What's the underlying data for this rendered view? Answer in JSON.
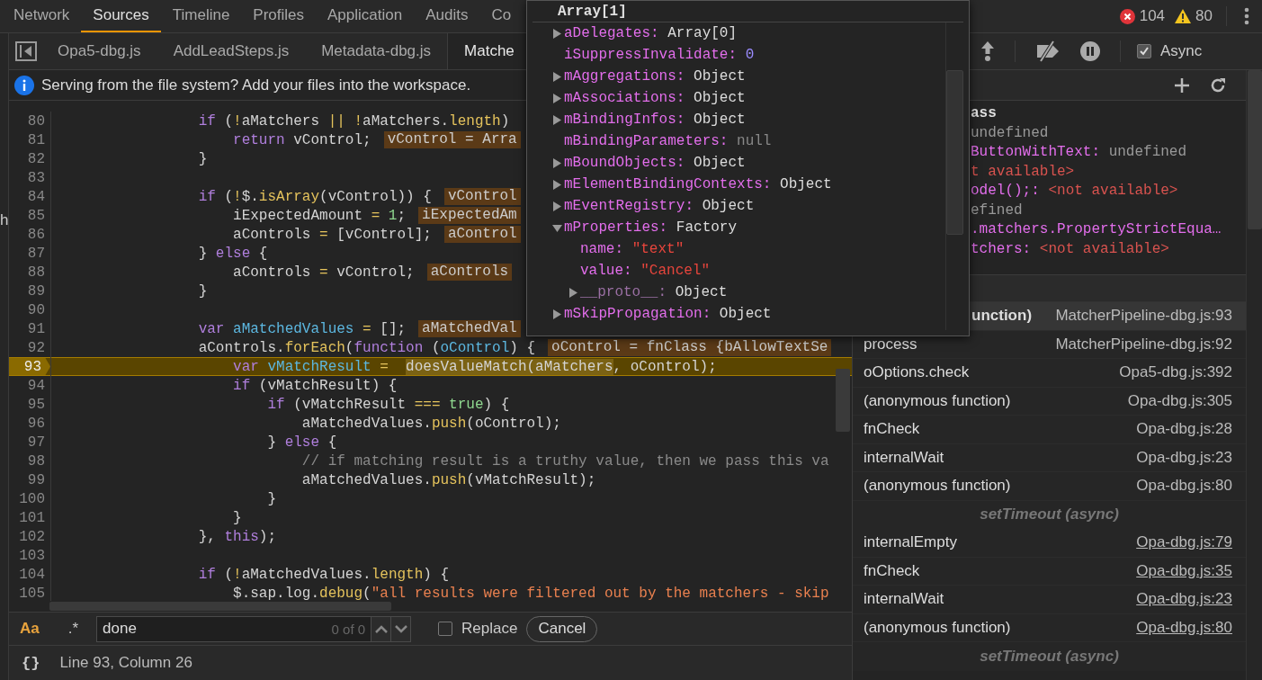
{
  "top_tabs": [
    {
      "label": "Network",
      "selected": false
    },
    {
      "label": "Sources",
      "selected": true
    },
    {
      "label": "Timeline",
      "selected": false
    },
    {
      "label": "Profiles",
      "selected": false
    },
    {
      "label": "Application",
      "selected": false
    },
    {
      "label": "Audits",
      "selected": false
    },
    {
      "label": "Co",
      "selected": false
    }
  ],
  "console_counts": {
    "errors": "104",
    "warnings": "80"
  },
  "navigator_edge_text": "h",
  "editor_tabs": [
    {
      "label": "Opa5-dbg.js",
      "selected": false
    },
    {
      "label": "AddLeadSteps.js",
      "selected": false
    },
    {
      "label": "Metadata-dbg.js",
      "selected": false
    },
    {
      "label": "Matche",
      "selected": true
    }
  ],
  "infobar": {
    "message": "Serving from the file system? Add your files into the workspace."
  },
  "code_lines": [
    {
      "number": "80",
      "current": false,
      "tokens": [
        {
          "kind": "keyword",
          "text": "                if"
        },
        {
          "kind": "plain",
          "text": " ("
        },
        {
          "kind": "operator",
          "text": "!"
        },
        {
          "kind": "plain",
          "text": "aMatchers "
        },
        {
          "kind": "operator",
          "text": "|| !"
        },
        {
          "kind": "plain",
          "text": "aMatchers."
        },
        {
          "kind": "method",
          "text": "length"
        },
        {
          "kind": "plain",
          "text": ")"
        }
      ]
    },
    {
      "number": "81",
      "current": false,
      "tokens": [
        {
          "kind": "keyword",
          "text": "                    return"
        },
        {
          "kind": "plain",
          "text": " vControl;"
        }
      ],
      "inline_value": "vControl = Arra"
    },
    {
      "number": "82",
      "current": false,
      "tokens": [
        {
          "kind": "plain",
          "text": "                }"
        }
      ]
    },
    {
      "number": "83",
      "current": false
    },
    {
      "number": "84",
      "current": false,
      "tokens": [
        {
          "kind": "keyword",
          "text": "                if"
        },
        {
          "kind": "plain",
          "text": " ("
        },
        {
          "kind": "operator",
          "text": "!"
        },
        {
          "kind": "plain",
          "text": "$."
        },
        {
          "kind": "method",
          "text": "isArray"
        },
        {
          "kind": "plain",
          "text": "(vControl)) {"
        }
      ],
      "inline_value": "vControl"
    },
    {
      "number": "85",
      "current": false,
      "tokens": [
        {
          "kind": "plain",
          "text": "                    iExpectedAmount "
        },
        {
          "kind": "operator",
          "text": "= "
        },
        {
          "kind": "number",
          "text": "1"
        },
        {
          "kind": "plain",
          "text": ";"
        }
      ],
      "inline_value": "iExpectedAm"
    },
    {
      "number": "86",
      "current": false,
      "tokens": [
        {
          "kind": "plain",
          "text": "                    aControls "
        },
        {
          "kind": "operator",
          "text": "="
        },
        {
          "kind": "plain",
          "text": " [vControl];"
        }
      ],
      "inline_value": "aControl"
    },
    {
      "number": "87",
      "current": false,
      "tokens": [
        {
          "kind": "plain",
          "text": "                } "
        },
        {
          "kind": "keyword",
          "text": "else"
        },
        {
          "kind": "plain",
          "text": " {"
        }
      ]
    },
    {
      "number": "88",
      "current": false,
      "tokens": [
        {
          "kind": "plain",
          "text": "                    aControls "
        },
        {
          "kind": "operator",
          "text": "="
        },
        {
          "kind": "plain",
          "text": " vControl;"
        }
      ],
      "inline_value": "aControls"
    },
    {
      "number": "89",
      "current": false,
      "tokens": [
        {
          "kind": "plain",
          "text": "                }"
        }
      ]
    },
    {
      "number": "90",
      "current": false
    },
    {
      "number": "91",
      "current": false,
      "tokens": [
        {
          "kind": "keyword",
          "text": "                var "
        },
        {
          "kind": "variable",
          "text": "aMatchedValues "
        },
        {
          "kind": "operator",
          "text": "="
        },
        {
          "kind": "plain",
          "text": " [];"
        }
      ],
      "inline_value": "aMatchedVal"
    },
    {
      "number": "92",
      "current": false,
      "tokens": [
        {
          "kind": "plain",
          "text": "                aControls."
        },
        {
          "kind": "method",
          "text": "forEach"
        },
        {
          "kind": "plain",
          "text": "("
        },
        {
          "kind": "keyword",
          "text": "function"
        },
        {
          "kind": "plain",
          "text": " ("
        },
        {
          "kind": "variable",
          "text": "oControl"
        },
        {
          "kind": "plain",
          "text": ") {"
        }
      ],
      "inline_value": "oControl = fnClass {bAllowTextSe"
    },
    {
      "number": "93",
      "current": true,
      "tokens": [
        {
          "kind": "keyword",
          "text": "                    var "
        },
        {
          "kind": "variable",
          "text": "vMatchResult "
        },
        {
          "kind": "operator",
          "text": "=  "
        },
        {
          "kind": "hover",
          "text": "doesValueMatch(aMatchers"
        },
        {
          "kind": "plain",
          "text": ", oControl);"
        }
      ]
    },
    {
      "number": "94",
      "current": false,
      "tokens": [
        {
          "kind": "keyword",
          "text": "                    if"
        },
        {
          "kind": "plain",
          "text": " (vMatchResult) {"
        }
      ]
    },
    {
      "number": "95",
      "current": false,
      "tokens": [
        {
          "kind": "keyword",
          "text": "                        if"
        },
        {
          "kind": "plain",
          "text": " (vMatchResult "
        },
        {
          "kind": "operator",
          "text": "=== "
        },
        {
          "kind": "literal",
          "text": "true"
        },
        {
          "kind": "plain",
          "text": ") {"
        }
      ]
    },
    {
      "number": "96",
      "current": false,
      "tokens": [
        {
          "kind": "plain",
          "text": "                            aMatchedValues."
        },
        {
          "kind": "method",
          "text": "push"
        },
        {
          "kind": "plain",
          "text": "(oControl);"
        }
      ]
    },
    {
      "number": "97",
      "current": false,
      "tokens": [
        {
          "kind": "plain",
          "text": "                        } "
        },
        {
          "kind": "keyword",
          "text": "else"
        },
        {
          "kind": "plain",
          "text": " {"
        }
      ]
    },
    {
      "number": "98",
      "current": false,
      "tokens": [
        {
          "kind": "comment",
          "text": "                            // if matching result is a truthy value, then we pass this va"
        }
      ]
    },
    {
      "number": "99",
      "current": false,
      "tokens": [
        {
          "kind": "plain",
          "text": "                            aMatchedValues."
        },
        {
          "kind": "method",
          "text": "push"
        },
        {
          "kind": "plain",
          "text": "(vMatchResult);"
        }
      ]
    },
    {
      "number": "100",
      "current": false,
      "tokens": [
        {
          "kind": "plain",
          "text": "                        }"
        }
      ]
    },
    {
      "number": "101",
      "current": false,
      "tokens": [
        {
          "kind": "plain",
          "text": "                    }"
        }
      ]
    },
    {
      "number": "102",
      "current": false,
      "tokens": [
        {
          "kind": "plain",
          "text": "                }, "
        },
        {
          "kind": "keyword",
          "text": "this"
        },
        {
          "kind": "plain",
          "text": ");"
        }
      ]
    },
    {
      "number": "103",
      "current": false
    },
    {
      "number": "104",
      "current": false,
      "tokens": [
        {
          "kind": "keyword",
          "text": "                if"
        },
        {
          "kind": "plain",
          "text": " ("
        },
        {
          "kind": "operator",
          "text": "!"
        },
        {
          "kind": "plain",
          "text": "aMatchedValues."
        },
        {
          "kind": "method",
          "text": "length"
        },
        {
          "kind": "plain",
          "text": ") {"
        }
      ]
    },
    {
      "number": "105",
      "current": false,
      "tokens": [
        {
          "kind": "plain",
          "text": "                    $.sap.log."
        },
        {
          "kind": "method",
          "text": "debug"
        },
        {
          "kind": "plain",
          "text": "("
        },
        {
          "kind": "string",
          "text": "\"all results were filtered out by the matchers - skip"
        }
      ]
    }
  ],
  "search": {
    "match_case_label": "Aa",
    "match_case": true,
    "regex_label": ".*",
    "regex": false,
    "value": "done",
    "count": "0 of 0",
    "replace_label": "Replace",
    "replace": false,
    "cancel_label": "Cancel"
  },
  "status_bar": {
    "format_label": "{}",
    "position": "Line 93, Column 26"
  },
  "debugger_toolbar": {
    "async_label": "Async",
    "async": true
  },
  "scope": [
    {
      "kind": "heading",
      "name": "ass"
    },
    {
      "kind": "value",
      "value": "undefined",
      "unavailable": false
    },
    {
      "kind": "property",
      "name": "ButtonWithText:",
      "value": "undefined",
      "unavailable": false
    },
    {
      "kind": "value",
      "value": "t available>",
      "unavailable": true
    },
    {
      "kind": "property",
      "name": "odel();:",
      "value": "<not available>",
      "unavailable": true
    },
    {
      "kind": "value",
      "value": "efined",
      "unavailable": false
    },
    {
      "kind": "name",
      "name": ".matchers.PropertyStrictEqua…"
    },
    {
      "kind": "property",
      "name": "tchers:",
      "value": "<not available>",
      "unavailable": true
    }
  ],
  "call_stack": [
    {
      "kind": "clipped-frame",
      "name": "unction)",
      "location": "MatcherPipeline-dbg.js:93",
      "selected": true,
      "linked": false
    },
    {
      "kind": "frame",
      "name": "process",
      "location": "MatcherPipeline-dbg.js:92",
      "selected": false,
      "linked": false
    },
    {
      "kind": "frame",
      "name": "oOptions.check",
      "location": "Opa5-dbg.js:392",
      "selected": false,
      "linked": false
    },
    {
      "kind": "frame",
      "name": "(anonymous function)",
      "location": "Opa-dbg.js:305",
      "selected": false,
      "linked": false
    },
    {
      "kind": "frame",
      "name": "fnCheck",
      "location": "Opa-dbg.js:28",
      "selected": false,
      "linked": false
    },
    {
      "kind": "frame",
      "name": "internalWait",
      "location": "Opa-dbg.js:23",
      "selected": false,
      "linked": false
    },
    {
      "kind": "frame",
      "name": "(anonymous function)",
      "location": "Opa-dbg.js:80",
      "selected": false,
      "linked": false
    },
    {
      "kind": "async",
      "label": "setTimeout (async)",
      "selected": false
    },
    {
      "kind": "frame",
      "name": "internalEmpty",
      "location": "Opa-dbg.js:79",
      "selected": false,
      "linked": true
    },
    {
      "kind": "frame",
      "name": "fnCheck",
      "location": "Opa-dbg.js:35",
      "selected": false,
      "linked": true
    },
    {
      "kind": "frame",
      "name": "internalWait",
      "location": "Opa-dbg.js:23",
      "selected": false,
      "linked": true
    },
    {
      "kind": "frame",
      "name": "(anonymous function)",
      "location": "Opa-dbg.js:80",
      "selected": false,
      "linked": true
    },
    {
      "kind": "async",
      "label": "setTimeout (async)",
      "selected": false
    }
  ],
  "popover": {
    "title": "Array[1]",
    "entries": [
      {
        "kind": "node",
        "name": "aDelegates:",
        "value": "Array[0]",
        "expanded": false
      },
      {
        "kind": "number",
        "name": "iSuppressInvalidate:",
        "value": "0"
      },
      {
        "kind": "node",
        "name": "mAggregations:",
        "value": "Object",
        "expanded": false
      },
      {
        "kind": "node",
        "name": "mAssociations:",
        "value": "Object",
        "expanded": false
      },
      {
        "kind": "node",
        "name": "mBindingInfos:",
        "value": "Object",
        "expanded": false
      },
      {
        "kind": "null",
        "name": "mBindingParameters:",
        "value": "null"
      },
      {
        "kind": "node",
        "name": "mBoundObjects:",
        "value": "Object",
        "expanded": false
      },
      {
        "kind": "node",
        "name": "mElementBindingContexts:",
        "value": "Object",
        "expanded": false
      },
      {
        "kind": "node",
        "name": "mEventRegistry:",
        "value": "Object",
        "expanded": false
      },
      {
        "kind": "node",
        "name": "mProperties:",
        "value": "Factory",
        "expanded": true,
        "children": [
          {
            "kind": "string",
            "name": "name:",
            "value": "\"text\""
          },
          {
            "kind": "string",
            "name": "value:",
            "value": "\"Cancel\""
          },
          {
            "kind": "proto",
            "name": "__proto__:",
            "value": "Object",
            "expanded": false
          }
        ]
      },
      {
        "kind": "node",
        "name": "mSkipPropagation:",
        "value": "Object",
        "expanded": false
      }
    ]
  }
}
